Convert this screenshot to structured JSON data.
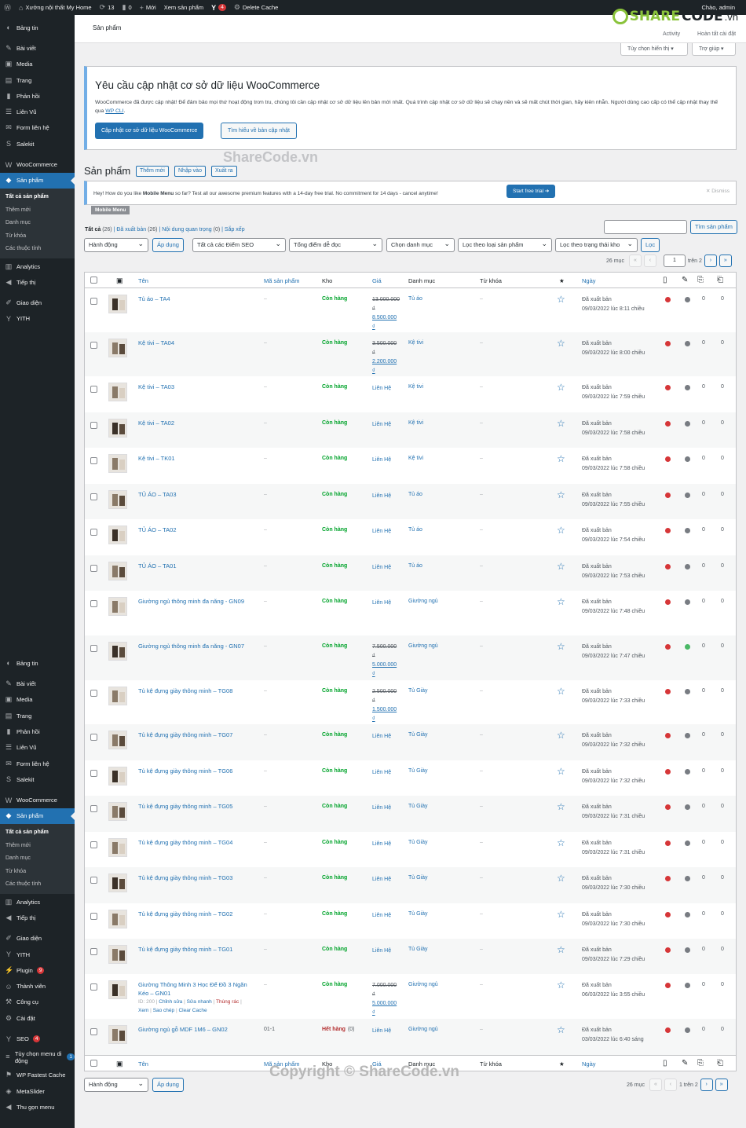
{
  "adminbar": {
    "site_name": "Xưởng nội thất My Home",
    "updates": "13",
    "comments": "0",
    "new_label": "Mới",
    "view_products": "Xem sản phẩm",
    "yoast_count": "4",
    "delete_cache": "Delete Cache",
    "greeting": "Chào, admin"
  },
  "sidebar": {
    "groups": [
      {
        "label": "Bảng tin",
        "icon": "dashboard-icon"
      },
      {
        "label": "Bài viết",
        "icon": "pin-icon"
      },
      {
        "label": "Media",
        "icon": "media-icon"
      },
      {
        "label": "Trang",
        "icon": "page-icon"
      },
      {
        "label": "Phản hồi",
        "icon": "comment-icon"
      },
      {
        "label": "Liên Vũ",
        "icon": "contact-icon"
      },
      {
        "label": "Form liên hệ",
        "icon": "mail-icon"
      },
      {
        "label": "Salekit",
        "icon": "salekit-icon"
      },
      {
        "label": "WooCommerce",
        "icon": "woo-icon"
      },
      {
        "label": "Sản phẩm",
        "icon": "product-icon"
      },
      {
        "label": "Analytics",
        "icon": "chart-icon"
      },
      {
        "label": "Tiếp thị",
        "icon": "megaphone-icon"
      },
      {
        "label": "Giao diện",
        "icon": "brush-icon"
      },
      {
        "label": "YITH",
        "icon": "yith-icon"
      },
      {
        "label": "Plugin",
        "icon": "plugin-icon",
        "badge": "9"
      },
      {
        "label": "Thành viên",
        "icon": "users-icon"
      },
      {
        "label": "Công cụ",
        "icon": "tools-icon"
      },
      {
        "label": "Cài đặt",
        "icon": "settings-icon"
      },
      {
        "label": "SEO",
        "icon": "seo-icon",
        "badge": "4"
      },
      {
        "label": "Tùy chọn menu di động",
        "icon": "menu-icon",
        "badge": "1"
      },
      {
        "label": "WP Fastest Cache",
        "icon": "cache-icon"
      },
      {
        "label": "MetaSlider",
        "icon": "slider-icon"
      },
      {
        "label": "Thu gọn menu",
        "icon": "collapse-icon"
      }
    ],
    "product_sub": [
      "Tất cả sản phẩm",
      "Thêm mới",
      "Danh mục",
      "Từ khóa",
      "Các thuộc tính"
    ]
  },
  "header": {
    "crumb": "Sản phẩm",
    "logo_share": "SHARE",
    "logo_code": "CODE",
    "logo_tld": ".vn",
    "activity": "Activity",
    "finish": "Hoàn tất cài đặt",
    "screen_options": "Tùy chọn hiển thị ▾",
    "help": "Trợ giúp ▾"
  },
  "notice": {
    "title": "Yêu cầu cập nhật cơ sở dữ liệu WooCommerce",
    "body": "WooCommerce đã được cập nhật! Để đảm bảo mọi thứ hoạt động trơn tru, chúng tôi cần cập nhật cơ sở dữ liệu lên bản mới nhất. Quá trình cập nhật cơ sở dữ liệu sẽ chạy nền và sẽ mất chút thời gian, hãy kiên nhẫn. Người dùng cao cấp có thể cập nhật thay thế qua ",
    "link": "WP CLI",
    "primary": "Cập nhật cơ sở dữ liệu WooCommerce",
    "secondary": "Tìm hiểu về bản cập nhật"
  },
  "watermark_top": "ShareCode.vn",
  "watermark_bottom": "Copyright © ShareCode.vn",
  "page": {
    "title": "Sản phẩm",
    "add_new": "Thêm mới",
    "import": "Nhập vào",
    "export": "Xuất ra"
  },
  "mobile_menu": {
    "text_pre": "Hey! How do you like ",
    "text_bold": "Mobile Menu",
    "text_post": " so far? Test all our awesome premium features with a 14-day free trial. No commitment for 14 days - cancel anytime!",
    "trial": "Start free trial ➔",
    "dismiss": "✕ Dismiss",
    "tag": "Mobile Menu"
  },
  "views": {
    "all": "Tất cả",
    "all_count": "(26)",
    "published": "Đã xuất bản",
    "published_count": "(26)",
    "cornerstone": "Nội dung quan trọng",
    "cornerstone_count": "(0)",
    "sort": "Sắp xếp"
  },
  "filters": {
    "bulk": "Hành động",
    "apply": "Áp dụng",
    "seo": "Tất cả các Điểm SEO",
    "readability": "Tổng điểm dễ đọc",
    "category": "Chọn danh mục",
    "type": "Lọc theo loại sản phẩm",
    "stock": "Lọc theo trạng thái kho",
    "filter": "Lọc",
    "search_btn": "Tìm sản phẩm",
    "items": "26 mục",
    "page": "1",
    "of": "trên 2",
    "first": "«",
    "prev": "‹",
    "next": "›",
    "last": "»",
    "bottom_of": "1 trên 2"
  },
  "columns": {
    "name": "Tên",
    "sku": "Mã sản phẩm",
    "stock": "Kho",
    "price": "Giá",
    "category": "Danh mục",
    "tags": "Từ khóa",
    "featured": "★",
    "date": "Ngày"
  },
  "rows": [
    {
      "name": "Tủ áo – TA4",
      "sku": "–",
      "stock": "Còn hàng",
      "old": "13.000.000",
      "old_cur": "₫",
      "new": "8.500.000",
      "new_cur": "₫",
      "cat": "Tủ áo",
      "date1": "Đã xuất bản",
      "date2": "09/03/2022 lúc 8:11 chiều",
      "seo": "#d63638",
      "read": "#787c82",
      "n1": "0",
      "n2": "0"
    },
    {
      "name": "Kệ tivi – TA04",
      "sku": "–",
      "stock": "Còn hàng",
      "old": "3.500.000",
      "old_cur": "₫",
      "new": "2.200.000",
      "new_cur": "₫",
      "cat": "Kệ tivi",
      "date1": "Đã xuất bản",
      "date2": "09/03/2022 lúc 8:00 chiều",
      "seo": "#d63638",
      "read": "#787c82",
      "n1": "0",
      "n2": "0"
    },
    {
      "name": "Kệ tivi – TA03",
      "sku": "–",
      "stock": "Còn hàng",
      "price": "Liên Hệ",
      "cat": "Kệ tivi",
      "date1": "Đã xuất bản",
      "date2": "09/03/2022 lúc 7:59 chiều",
      "seo": "#d63638",
      "read": "#787c82",
      "n1": "0",
      "n2": "0"
    },
    {
      "name": "Kệ tivi – TA02",
      "sku": "–",
      "stock": "Còn hàng",
      "price": "Liên Hệ",
      "cat": "Kệ tivi",
      "date1": "Đã xuất bản",
      "date2": "09/03/2022 lúc 7:58 chiều",
      "seo": "#d63638",
      "read": "#787c82",
      "n1": "0",
      "n2": "0"
    },
    {
      "name": "Kệ tivi – TK01",
      "sku": "–",
      "stock": "Còn hàng",
      "price": "Liên Hệ",
      "cat": "Kệ tivi",
      "date1": "Đã xuất bản",
      "date2": "09/03/2022 lúc 7:58 chiều",
      "seo": "#d63638",
      "read": "#787c82",
      "n1": "0",
      "n2": "0"
    },
    {
      "name": "TỦ ÁO – TA03",
      "sku": "–",
      "stock": "Còn hàng",
      "price": "Liên Hệ",
      "cat": "Tủ áo",
      "date1": "Đã xuất bản",
      "date2": "09/03/2022 lúc 7:55 chiều",
      "seo": "#d63638",
      "read": "#787c82",
      "n1": "0",
      "n2": "0"
    },
    {
      "name": "TỦ ÁO – TA02",
      "sku": "–",
      "stock": "Còn hàng",
      "price": "Liên Hệ",
      "cat": "Tủ áo",
      "date1": "Đã xuất bản",
      "date2": "09/03/2022 lúc 7:54 chiều",
      "seo": "#d63638",
      "read": "#787c82",
      "n1": "0",
      "n2": "0"
    },
    {
      "name": "TỦ ÁO – TA01",
      "sku": "–",
      "stock": "Còn hàng",
      "price": "Liên Hệ",
      "cat": "Tủ áo",
      "date1": "Đã xuất bản",
      "date2": "09/03/2022 lúc 7:53 chiều",
      "seo": "#d63638",
      "read": "#787c82",
      "n1": "0",
      "n2": "0"
    },
    {
      "name": "Giường ngủ thông minh đa năng - GN09",
      "sku": "–",
      "stock": "Còn hàng",
      "price": "Liên Hệ",
      "cat": "Giường ngủ",
      "date1": "Đã xuất bản",
      "date2": "09/03/2022 lúc 7:48 chiều",
      "seo": "#d63638",
      "read": "#787c82",
      "n1": "0",
      "n2": "0"
    },
    {
      "name": "Giường ngủ thông minh đa năng - GN07",
      "sku": "–",
      "stock": "Còn hàng",
      "old": "7.500.000",
      "old_cur": "₫",
      "new": "5.000.000",
      "new_cur": "₫",
      "cat": "Giường ngủ",
      "date1": "Đã xuất bản",
      "date2": "09/03/2022 lúc 7:47 chiều",
      "seo": "#d63638",
      "read": "#4ab866",
      "n1": "0",
      "n2": "0"
    },
    {
      "name": "Tủ kệ đựng giày thông minh – TG08",
      "sku": "–",
      "stock": "Còn hàng",
      "old": "2.500.000",
      "old_cur": "₫",
      "new": "1.500.000",
      "new_cur": "₫",
      "cat": "Tủ Giày",
      "date1": "Đã xuất bản",
      "date2": "09/03/2022 lúc 7:33 chiều",
      "seo": "#d63638",
      "read": "#787c82",
      "n1": "0",
      "n2": "0"
    },
    {
      "name": "Tủ kệ đựng giày thông minh – TG07",
      "sku": "–",
      "stock": "Còn hàng",
      "price": "Liên Hệ",
      "cat": "Tủ Giày",
      "date1": "Đã xuất bản",
      "date2": "09/03/2022 lúc 7:32 chiều",
      "seo": "#d63638",
      "read": "#787c82",
      "n1": "0",
      "n2": "0"
    },
    {
      "name": "Tủ kệ đựng giày thông minh – TG06",
      "sku": "–",
      "stock": "Còn hàng",
      "price": "Liên Hệ",
      "cat": "Tủ Giày",
      "date1": "Đã xuất bản",
      "date2": "09/03/2022 lúc 7:32 chiều",
      "seo": "#d63638",
      "read": "#787c82",
      "n1": "0",
      "n2": "0"
    },
    {
      "name": "Tủ kệ đựng giày thông minh – TG05",
      "sku": "–",
      "stock": "Còn hàng",
      "price": "Liên Hệ",
      "cat": "Tủ Giày",
      "date1": "Đã xuất bản",
      "date2": "09/03/2022 lúc 7:31 chiều",
      "seo": "#d63638",
      "read": "#787c82",
      "n1": "0",
      "n2": "0"
    },
    {
      "name": "Tủ kệ đựng giày thông minh – TG04",
      "sku": "–",
      "stock": "Còn hàng",
      "price": "Liên Hệ",
      "cat": "Tủ Giày",
      "date1": "Đã xuất bản",
      "date2": "09/03/2022 lúc 7:31 chiều",
      "seo": "#d63638",
      "read": "#787c82",
      "n1": "0",
      "n2": "0"
    },
    {
      "name": "Tủ kệ đựng giày thông minh – TG03",
      "sku": "–",
      "stock": "Còn hàng",
      "price": "Liên Hệ",
      "cat": "Tủ Giày",
      "date1": "Đã xuất bản",
      "date2": "09/03/2022 lúc 7:30 chiều",
      "seo": "#d63638",
      "read": "#787c82",
      "n1": "0",
      "n2": "0"
    },
    {
      "name": "Tủ kệ đựng giày thông minh – TG02",
      "sku": "–",
      "stock": "Còn hàng",
      "price": "Liên Hệ",
      "cat": "Tủ Giày",
      "date1": "Đã xuất bản",
      "date2": "09/03/2022 lúc 7:30 chiều",
      "seo": "#d63638",
      "read": "#787c82",
      "n1": "0",
      "n2": "0"
    },
    {
      "name": "Tủ kệ đựng giày thông minh – TG01",
      "sku": "–",
      "stock": "Còn hàng",
      "price": "Liên Hệ",
      "cat": "Tủ Giày",
      "date1": "Đã xuất bản",
      "date2": "09/03/2022 lúc 7:29 chiều",
      "seo": "#d63638",
      "read": "#787c82",
      "n1": "0",
      "n2": "0"
    },
    {
      "name": "Giường Thông Minh 3 Học Để Đồ 3 Ngăn Kéo – GN01",
      "sku": "–",
      "stock": "Còn hàng",
      "old": "7.000.000",
      "old_cur": "₫",
      "new": "5.000.000",
      "new_cur": "₫",
      "cat": "Giường ngủ",
      "date1": "Đã xuất bản",
      "date2": "06/03/2022 lúc 3:55 chiều",
      "seo": "#d63638",
      "read": "#787c82",
      "n1": "0",
      "n2": "0",
      "meta": {
        "id": "ID: 200",
        "edit": "Chỉnh sửa",
        "quick": "Sửa nhanh",
        "trash": "Thùng rác",
        "view": "Xem",
        "dup": "Sao chép",
        "cache": "Clear Cache"
      }
    },
    {
      "name": "Giường ngủ gỗ MDF 1M6 – GN02",
      "sku": "01-1",
      "stock": "Hết hàng",
      "stock_qty": "(0)",
      "price": "Liên Hệ",
      "cat": "Giường ngủ",
      "date1": "Đã xuất bản",
      "date2": "03/03/2022 lúc 6:40 sáng",
      "seo": "#d63638",
      "read": "#787c82",
      "n1": "0",
      "n2": "0"
    }
  ]
}
